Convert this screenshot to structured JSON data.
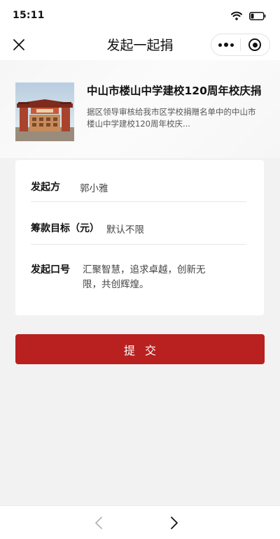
{
  "status": {
    "time": "15:11",
    "icons": [
      "wifi-icon",
      "battery-icon"
    ]
  },
  "nav": {
    "title": "发起一起捐",
    "close_icon": "close-icon",
    "more_icon": "more-dots-icon",
    "exit_icon": "miniprogram-exit-icon"
  },
  "project": {
    "title": "中山市楼山中学建校120周年校庆捐",
    "description": "据区领导审核给我市区学校捐赠名单中的中山市楼山中学建校120周年校庆..."
  },
  "form": {
    "initiator": {
      "label": "发起方",
      "value": "郭小雅"
    },
    "goal": {
      "label": "筹款目标（元）",
      "value": "默认不限"
    },
    "slogan": {
      "label": "发起口号",
      "value": "汇聚智慧，追求卓越，创新无限，共创辉煌。"
    }
  },
  "submit": {
    "label": "提交"
  },
  "colors": {
    "accent": "#b8211f",
    "background": "#f2f2f2"
  }
}
